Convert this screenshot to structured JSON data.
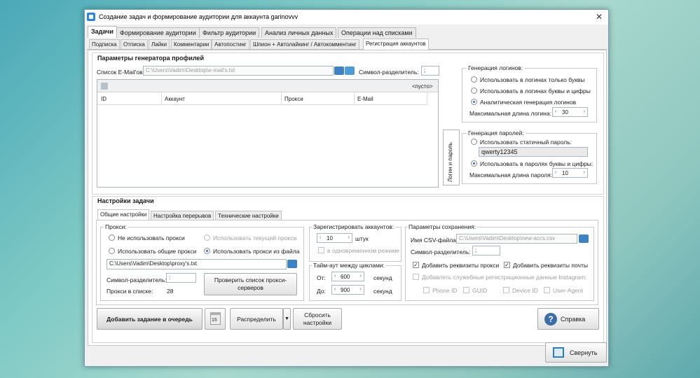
{
  "window": {
    "title": "Создание задач и формирование аудитории для аккаунта garinovvv",
    "close": "✕"
  },
  "main_tabs": [
    "Задачи",
    "Формирование аудитории",
    "Фильтр аудитории",
    "Анализ личных данных",
    "Операции над списками"
  ],
  "sub_tabs": [
    "Подписка",
    "Отписка",
    "Лайки",
    "Комментарии",
    "Автопостинг",
    "Шпион + Автолайкинг / Автокомментинг",
    "Регистрация аккаунтов"
  ],
  "profile_gen": {
    "header": "Параметры генератора профилей",
    "email_label": "Список E-Mail'ов:",
    "email_value": "C:\\Users\\Vadim\\Desktop\\e-mail's.txt",
    "sep_label": "Символ-разделитель:",
    "sep_value": ";",
    "empty": "<пусто>",
    "columns": [
      "ID",
      "Аккаунт",
      "Прокси",
      "E-Mail"
    ]
  },
  "side_tab": "Логин и пароль",
  "logins": {
    "title": "Генерация логинов:",
    "opt1": "Использовать в логинах только буквы",
    "opt2": "Использовать в логинах буквы и цифры",
    "opt3": "Аналитическая генерация логинов",
    "max_label": "Максимальная длина логина:",
    "max_value": "30"
  },
  "passwords": {
    "title": "Генерация паролей:",
    "opt1": "Использовать статичный пароль:",
    "static_value": "qwerty12345",
    "opt2": "Использовать в паролях буквы и цифры:",
    "max_label": "Максимальная длина пароля:",
    "max_value": "10"
  },
  "task": {
    "header": "Настройки задачи",
    "tabs": [
      "Общие настройки",
      "Настройка перерывов",
      "Технические настройки"
    ]
  },
  "proxy": {
    "title": "Прокси:",
    "opt_none": "Не использовать прокси",
    "opt_current": "Использовать текущий прокси",
    "opt_common": "Использовать общие прокси",
    "opt_file": "Использовать прокси из файла",
    "file_value": "C:\\Users\\Vadim\\Desktop\\proxy's.txt",
    "sep_label": "Символ-разделитель:",
    "sep_value": ":",
    "count_label": "Прокси в списке:",
    "count_value": "28",
    "check_btn": "Проверить список прокси-серверов"
  },
  "register": {
    "title": "Зарегистрировать аккаунтов:",
    "value": "10",
    "unit": "штук",
    "parallel": "в одновременном режиме"
  },
  "timeout": {
    "title": "Тайм-аут между циклами:",
    "from_label": "От:",
    "from_value": "600",
    "to_label": "До:",
    "to_value": "900",
    "unit": "секунд"
  },
  "save": {
    "title": "Параметры сохранения:",
    "csv_label": "Имя CSV-файла:",
    "csv_value": "C:\\Users\\Vadim\\Desktop\\new-accs.csv",
    "sep_label": "Символ-разделитель:",
    "sep_value": ";",
    "add_proxy": "Добавить реквизиты прокси",
    "add_mail": "Добавить реквизиты почты",
    "add_service": "Добавлять служебные регистрационные данные Instagram:",
    "phone_id": "Phone ID",
    "guid": "GUID",
    "device_id": "Device ID",
    "user_agent": "User-Agent"
  },
  "bottom": {
    "add_btn": "Добавить задание в очередь",
    "cal_num": "15",
    "distribute_btn": "Распределить",
    "reset_btn": "Сбросить настройки",
    "help_btn": "Справка",
    "minimize_btn": "Свернуть"
  }
}
